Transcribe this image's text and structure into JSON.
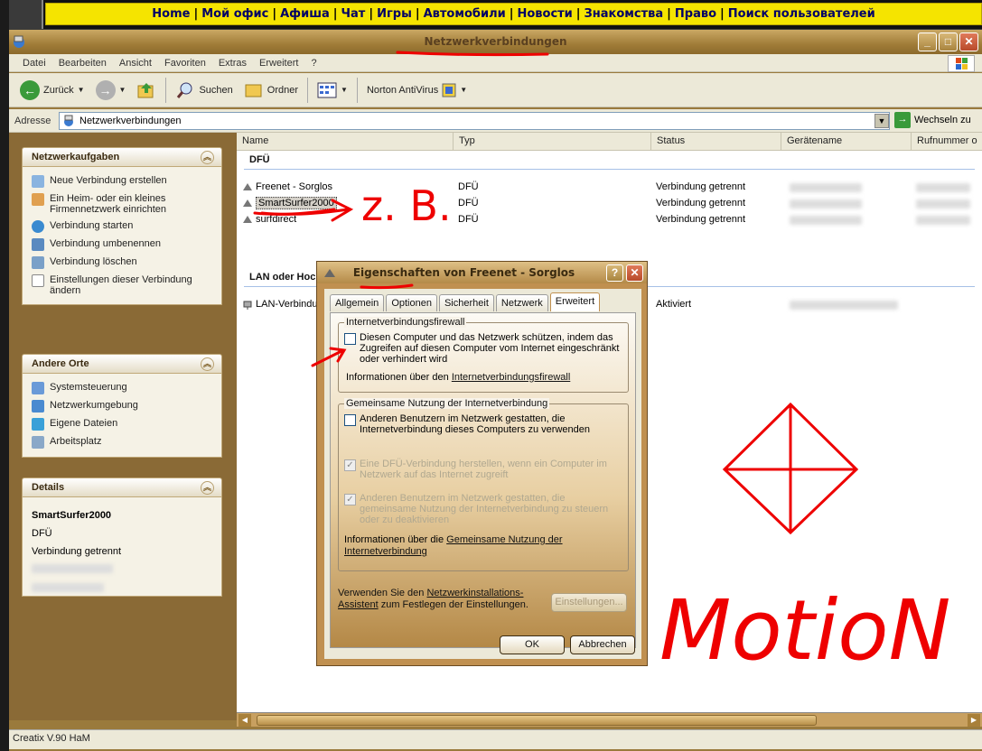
{
  "top_nav": {
    "links": [
      "Home",
      "Мой офис",
      "Афиша",
      "Чат",
      "Игры",
      "Автомобили",
      "Новости",
      "Знакомства",
      "Право",
      "Поиск пользователей"
    ]
  },
  "window": {
    "title": "Netzwerkverbindungen",
    "menu": [
      "Datei",
      "Bearbeiten",
      "Ansicht",
      "Favoriten",
      "Extras",
      "Erweitert",
      "?"
    ],
    "toolbar": {
      "back": "Zurück",
      "search": "Suchen",
      "folders": "Ordner",
      "norton": "Norton AntiVirus"
    },
    "address": {
      "label": "Adresse",
      "value": "Netzwerkverbindungen",
      "go": "Wechseln zu"
    },
    "status": "Creatix V.90 HaM"
  },
  "sidebar": {
    "tasks": {
      "title": "Netzwerkaufgaben",
      "items": [
        "Neue Verbindung erstellen",
        "Ein Heim- oder ein kleines Firmennetzwerk einrichten",
        "Verbindung starten",
        "Verbindung umbenennen",
        "Verbindung löschen",
        "Einstellungen dieser Verbindung ändern"
      ]
    },
    "places": {
      "title": "Andere Orte",
      "items": [
        "Systemsteuerung",
        "Netzwerkumgebung",
        "Eigene Dateien",
        "Arbeitsplatz"
      ]
    },
    "details": {
      "title": "Details",
      "name": "SmartSurfer2000",
      "type": "DFÜ",
      "status": "Verbindung getrennt"
    }
  },
  "list": {
    "columns": [
      "Name",
      "Typ",
      "Status",
      "Gerätename",
      "Rufnummer o"
    ],
    "groups": [
      {
        "title": "DFÜ",
        "rows": [
          {
            "name": "Freenet - Sorglos",
            "type": "DFÜ",
            "status": "Verbindung getrennt"
          },
          {
            "name": "SmartSurfer2000",
            "type": "DFÜ",
            "status": "Verbindung getrennt"
          },
          {
            "name": "surfdirect",
            "type": "DFÜ",
            "status": "Verbindung getrennt"
          }
        ]
      },
      {
        "title": "LAN oder Hochgeschwindigkeitsinternet",
        "rows": [
          {
            "name": "LAN-Verbindung",
            "type": "",
            "status": "Aktiviert"
          }
        ]
      }
    ]
  },
  "dialog": {
    "title": "Eigenschaften von Freenet - Sorglos",
    "tabs": [
      "Allgemein",
      "Optionen",
      "Sicherheit",
      "Netzwerk",
      "Erweitert"
    ],
    "active_tab": 4,
    "firewall": {
      "legend": "Internetverbindungsfirewall",
      "checkbox": "Diesen Computer und das Netzwerk schützen, indem das Zugreifen auf diesen Computer vom Internet eingeschränkt oder verhindert wird",
      "info_prefix": "Informationen über den ",
      "info_link": "Internetverbindungsfirewall"
    },
    "sharing": {
      "legend": "Gemeinsame Nutzung der Internetverbindung",
      "cb1": "Anderen Benutzern im Netzwerk gestatten, die Internetverbindung dieses Computers zu verwenden",
      "cb2": "Eine DFÜ-Verbindung herstellen, wenn ein Computer im Netzwerk auf das Internet zugreift",
      "cb3": "Anderen Benutzern im Netzwerk gestatten, die gemeinsame Nutzung der Internetverbindung zu steuern oder zu deaktivieren",
      "info_prefix": "Informationen über die ",
      "info_link": "Gemeinsame Nutzung der Internetverbindung"
    },
    "wizard_prefix": "Verwenden Sie den ",
    "wizard_link": "Netzwerkinstallations-Assistent",
    "wizard_suffix": " zum Festlegen der Einstellungen.",
    "settings_button": "Einstellungen...",
    "ok": "OK",
    "cancel": "Abbrechen"
  },
  "annotations": {
    "zb": "z. B.",
    "motion": "MotioN"
  }
}
